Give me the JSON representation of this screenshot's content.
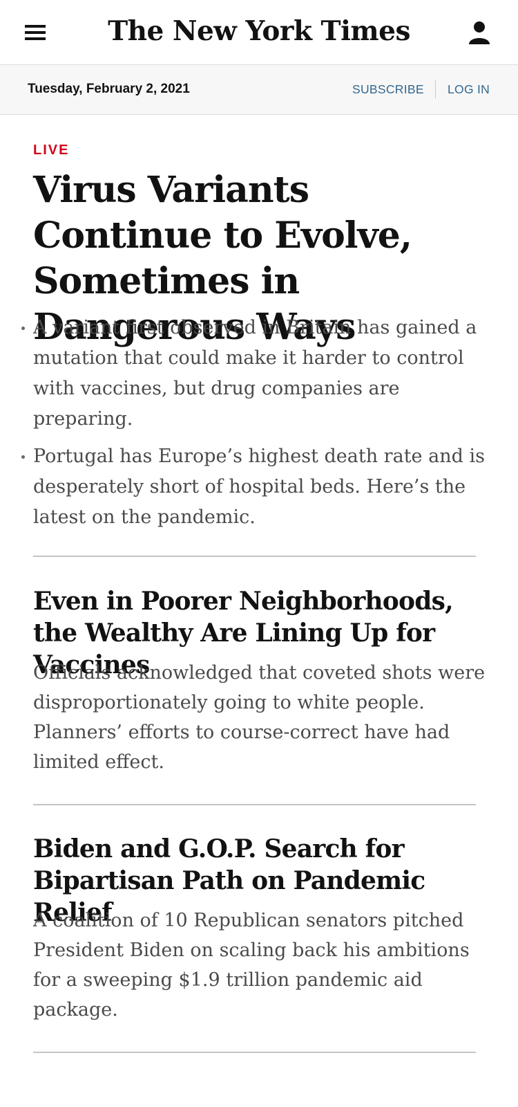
{
  "masthead": {
    "logo_text": "The New York Times",
    "menu_icon": "hamburger-menu-icon",
    "account_icon": "user-account-icon"
  },
  "subbar": {
    "date": "Tuesday, February 2, 2021",
    "subscribe_label": "SUBSCRIBE",
    "login_label": "LOG IN"
  },
  "lead_story": {
    "label": "LIVE",
    "headline": "Virus Variants Continue to Evolve, Sometimes in Dangerous Ways",
    "bullets": [
      "A variant first observed in Britain has gained a mutation that could make it harder to control with vaccines, but drug companies are preparing.",
      "Portugal has Europe’s highest death rate and is desperately short of hospital beds. Here’s the latest on the pandemic."
    ]
  },
  "stories": [
    {
      "headline": "Even in Poorer Neighborhoods, the Wealthy Are Lining Up for Vaccines",
      "summary": "Officials acknowledged that coveted shots were disproportionately going to white people. Planners’ efforts to course-correct have had limited effect."
    },
    {
      "headline": "Biden and G.O.P. Search for Bipartisan Path on Pandemic Relief",
      "summary": "A coalition of 10 Republican senators pitched President Biden on scaling back his ambitions for a sweeping $1.9 trillion pandemic aid package."
    }
  ],
  "colors": {
    "live_red": "#d0021b",
    "link_blue": "#326891",
    "summary_gray": "#4a4a4a"
  }
}
